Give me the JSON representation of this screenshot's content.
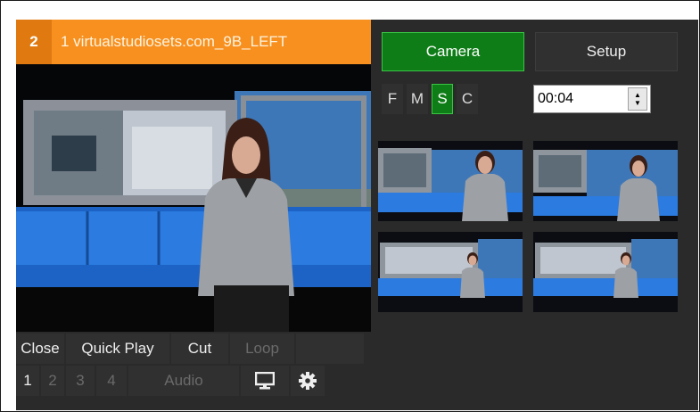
{
  "header": {
    "number": "2",
    "title": "1 virtualstudiosets.com_9B_LEFT"
  },
  "controls": {
    "row1": [
      {
        "label": "Close",
        "state": "normal"
      },
      {
        "label": "Quick Play",
        "state": "normal"
      },
      {
        "label": "Cut",
        "state": "normal"
      },
      {
        "label": "Loop",
        "state": "dim"
      }
    ],
    "row2": [
      {
        "label": "1",
        "state": "normal"
      },
      {
        "label": "2",
        "state": "dim"
      },
      {
        "label": "3",
        "state": "dim"
      },
      {
        "label": "4",
        "state": "dim"
      },
      {
        "label": "Audio",
        "state": "dim"
      }
    ],
    "monitor_icon": "monitor-icon",
    "settings_icon": "gear-icon"
  },
  "right": {
    "camera_label": "Camera",
    "setup_label": "Setup",
    "modes": [
      "F",
      "M",
      "S",
      "C"
    ],
    "active_mode": "S",
    "duration_value": "00:04"
  },
  "colors": {
    "accent_orange": "#f7901e",
    "active_green": "#0f7d17",
    "panel_bg": "#2a2a2a"
  }
}
